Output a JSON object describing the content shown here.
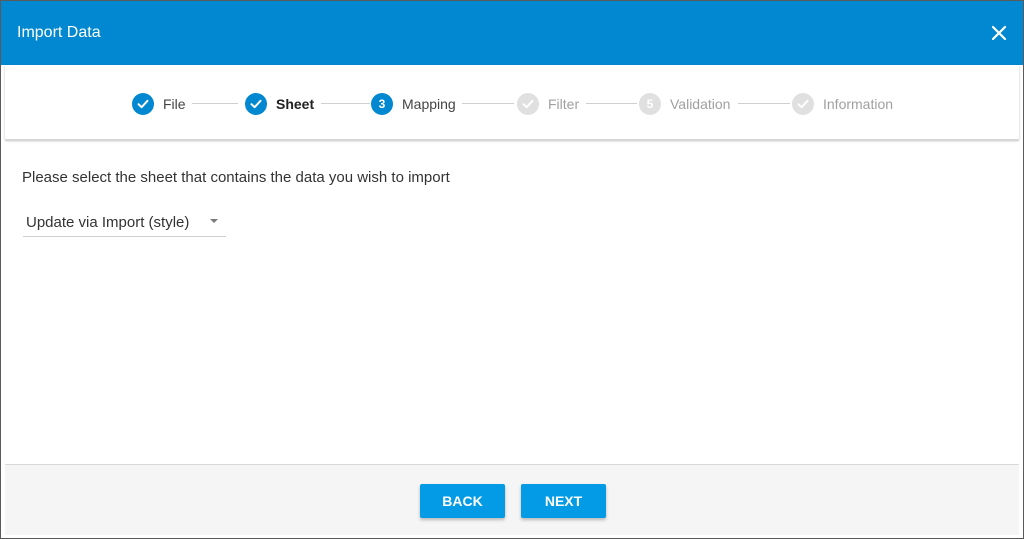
{
  "dialog": {
    "title": "Import Data",
    "close_icon": "close-icon"
  },
  "stepper": {
    "steps": [
      {
        "label": "File",
        "state": "done",
        "marker": "check"
      },
      {
        "label": "Sheet",
        "state": "current",
        "marker": "check"
      },
      {
        "label": "Mapping",
        "state": "next",
        "marker": "3"
      },
      {
        "label": "Filter",
        "state": "todo",
        "marker": "check"
      },
      {
        "label": "Validation",
        "state": "todo",
        "marker": "5"
      },
      {
        "label": "Information",
        "state": "todo",
        "marker": "check"
      }
    ]
  },
  "content": {
    "prompt": "Please select the sheet that contains the data you wish to import",
    "sheet_select": {
      "value": "Update via Import (style)"
    }
  },
  "footer": {
    "back_label": "BACK",
    "next_label": "NEXT"
  },
  "colors": {
    "header": "#0288d1",
    "active_step": "#0288d1",
    "inactive_step": "#e0e0e0",
    "button": "#039be5"
  }
}
